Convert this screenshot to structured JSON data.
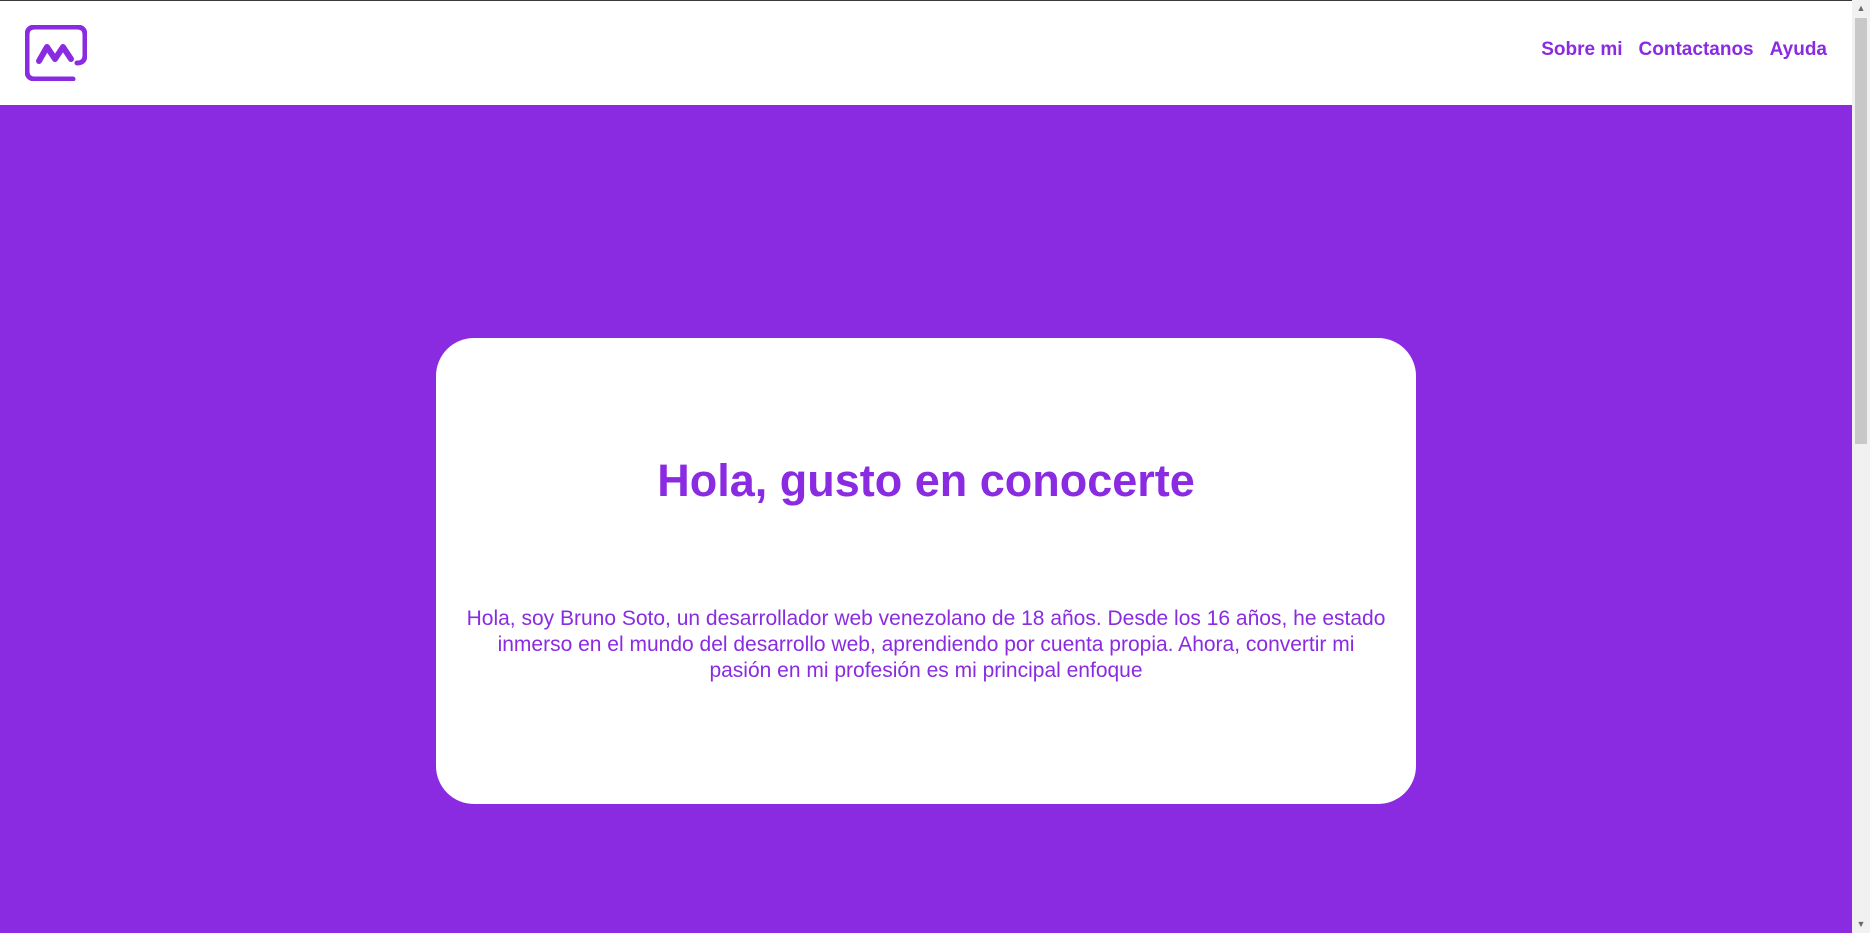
{
  "header": {
    "logo_icon": "m-logo-icon",
    "nav": [
      {
        "label": "Sobre mi"
      },
      {
        "label": "Contactanos"
      },
      {
        "label": "Ayuda"
      }
    ]
  },
  "hero": {
    "title": "Hola, gusto en conocerte",
    "text": "Hola, soy Bruno Soto, un desarrollador web venezolano de 18 años. Desde los 16 años, he estado inmerso en el mundo del desarrollo web, aprendiendo por cuenta propia. Ahora, convertir mi pasión en mi profesión es mi principal enfoque"
  },
  "colors": {
    "accent": "#8a2be2",
    "card_background": "#ffffff",
    "header_background": "#ffffff"
  },
  "scrollbar": {
    "up_icon": "chevron-up-icon",
    "down_icon": "chevron-down-icon"
  }
}
